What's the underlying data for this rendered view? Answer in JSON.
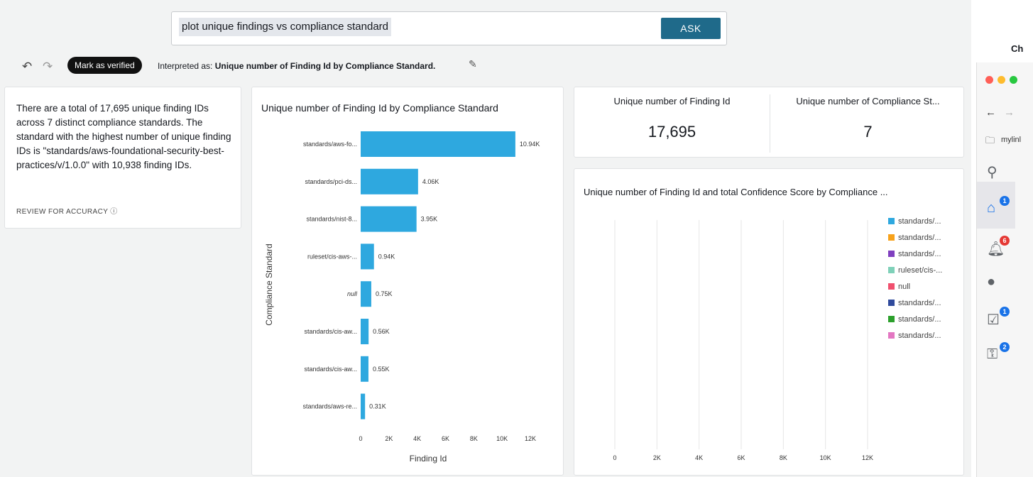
{
  "query": {
    "text": "plot unique findings vs compliance standard",
    "ask_label": "ASK"
  },
  "toolbar": {
    "verify_label": "Mark as verified",
    "interpreted_prefix": "Interpreted as: ",
    "interpreted_value": "Unique number of Finding Id by Compliance Standard."
  },
  "summary": {
    "text": "There are a total of 17,695 unique finding IDs across 7 distinct compliance standards. The standard with the highest number of unique finding IDs is \"standards/aws-foundational-security-best-practices/v/1.0.0\" with 10,938 finding IDs.",
    "review_label": "REVIEW FOR ACCURACY"
  },
  "kpi": {
    "label1": "Unique number of Finding Id",
    "value1": "17,695",
    "label2": "Unique number of Compliance St...",
    "value2": "7"
  },
  "chart_data": [
    {
      "type": "bar",
      "orientation": "horizontal",
      "title": "Unique number of Finding Id by Compliance Standard",
      "xlabel": "Finding Id",
      "ylabel": "Compliance Standard",
      "categories": [
        "standards/aws-fo...",
        "standards/pci-ds...",
        "standards/nist-8...",
        "ruleset/cis-aws-...",
        "null",
        "standards/cis-aw...",
        "standards/cis-aw...",
        "standards/aws-re..."
      ],
      "values": [
        10940,
        4060,
        3950,
        940,
        750,
        560,
        550,
        310
      ],
      "value_labels": [
        "10.94K",
        "4.06K",
        "3.95K",
        "0.94K",
        "0.75K",
        "0.56K",
        "0.55K",
        "0.31K"
      ],
      "xticks": [
        "0",
        "2K",
        "4K",
        "6K",
        "8K",
        "10K",
        "12K"
      ],
      "xlim": [
        0,
        12000
      ],
      "color": "#2ea8df"
    },
    {
      "type": "bar",
      "title": "Unique number of Finding Id and total Confidence Score by Compliance ...",
      "xticks": [
        "0",
        "2K",
        "4K",
        "6K",
        "8K",
        "10K",
        "12K"
      ],
      "xlim": [
        0,
        12000
      ],
      "legend": [
        {
          "name": "standards/...",
          "color": "#2ea8df"
        },
        {
          "name": "standards/...",
          "color": "#f7a21b"
        },
        {
          "name": "standards/...",
          "color": "#7f3fbf"
        },
        {
          "name": "ruleset/cis-...",
          "color": "#7fd1b9"
        },
        {
          "name": "null",
          "color": "#f0506e"
        },
        {
          "name": "standards/...",
          "color": "#2f4a9c"
        },
        {
          "name": "standards/...",
          "color": "#2ca02c"
        },
        {
          "name": "standards/...",
          "color": "#e377c2"
        }
      ],
      "legend_position": "right"
    }
  ],
  "side": {
    "menu_app": "Ch",
    "bookmark": "mylinl",
    "badges": {
      "home": "1",
      "bell": "6",
      "tasks": "1",
      "keys": "2"
    }
  }
}
